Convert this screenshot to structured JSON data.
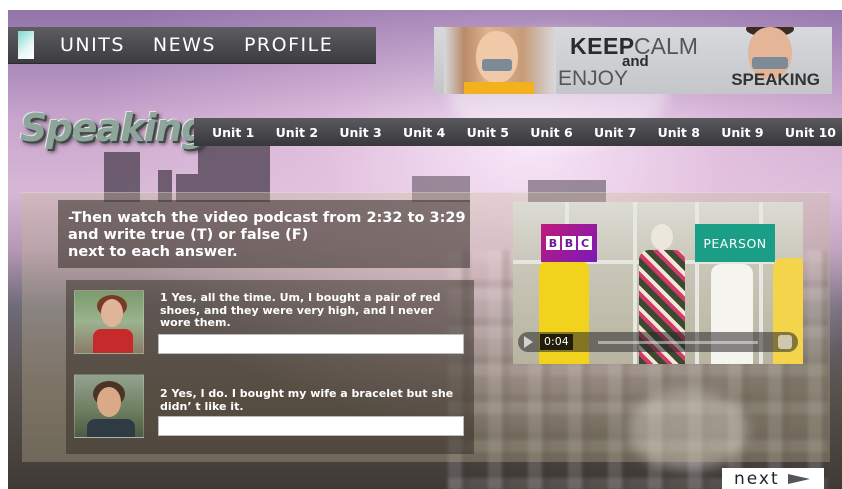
{
  "nav": {
    "items": [
      "UNITS",
      "NEWS",
      "PROFILE"
    ]
  },
  "banner": {
    "keep": "KEEP",
    "calm": "CALM",
    "and": "and",
    "enjoy": "ENJOY",
    "speaking": "SPEAKING"
  },
  "page_title": "Speaking",
  "units": [
    "Unit 1",
    "Unit 2",
    "Unit 3",
    "Unit 4",
    "Unit 5",
    "Unit 6",
    "Unit 7",
    "Unit 8",
    "Unit 9",
    "Unit 10"
  ],
  "instruction": {
    "line1": "-Then watch the video podcast from 2:32 to 3:29",
    "line2": "and write true (T) or false (F)",
    "line3": "next to each answer."
  },
  "questions": [
    {
      "text": "1    Yes, all the time. Um, I bought a pair of red shoes, and they were very high, and I never wore them.",
      "answer": ""
    },
    {
      "text": "2 Yes, I do. I bought my wife a bracelet but she didn’  t like it.",
      "answer": ""
    }
  ],
  "video": {
    "bbc_letters": [
      "B",
      "B",
      "C"
    ],
    "pearson": "PEARSON",
    "time": "0:04"
  },
  "next_label": "next",
  "colors": {
    "nav_bg": "#3c3c40",
    "pearson_green": "#1a9e86",
    "bbc_purple": "#7a1ab8",
    "title_green": "#8fa49a"
  }
}
